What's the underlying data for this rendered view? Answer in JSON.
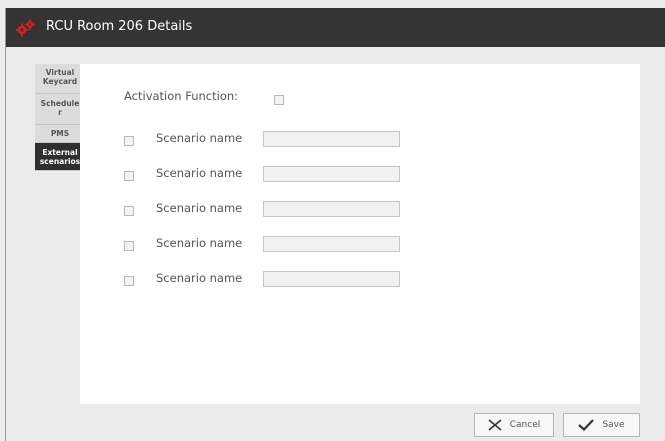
{
  "window": {
    "title": "RCU Room 206 Details"
  },
  "tabs": [
    {
      "label_line1": "Virtual",
      "label_line2": "Keycard"
    },
    {
      "label_line1": "Schedule",
      "label_line2": "r"
    },
    {
      "label_line1": "PMS",
      "label_line2": ""
    },
    {
      "label_line1": "External",
      "label_line2": "scenarios"
    }
  ],
  "activation": {
    "label": "Activation Function:",
    "checked": false
  },
  "scenarios": [
    {
      "label": "Scenario name",
      "value": "",
      "checked": false
    },
    {
      "label": "Scenario name",
      "value": "",
      "checked": false
    },
    {
      "label": "Scenario name",
      "value": "",
      "checked": false
    },
    {
      "label": "Scenario name",
      "value": "",
      "checked": false
    },
    {
      "label": "Scenario name",
      "value": "",
      "checked": false
    }
  ],
  "buttons": {
    "cancel_label": "Cancel",
    "save_label": "Save"
  },
  "icons": {
    "app": "gears-icon",
    "cancel": "close-icon",
    "save": "checkmark-icon"
  },
  "colors": {
    "titlebar": "#343434",
    "accent": "#d92020",
    "active_tab": "#2f2f2f"
  }
}
